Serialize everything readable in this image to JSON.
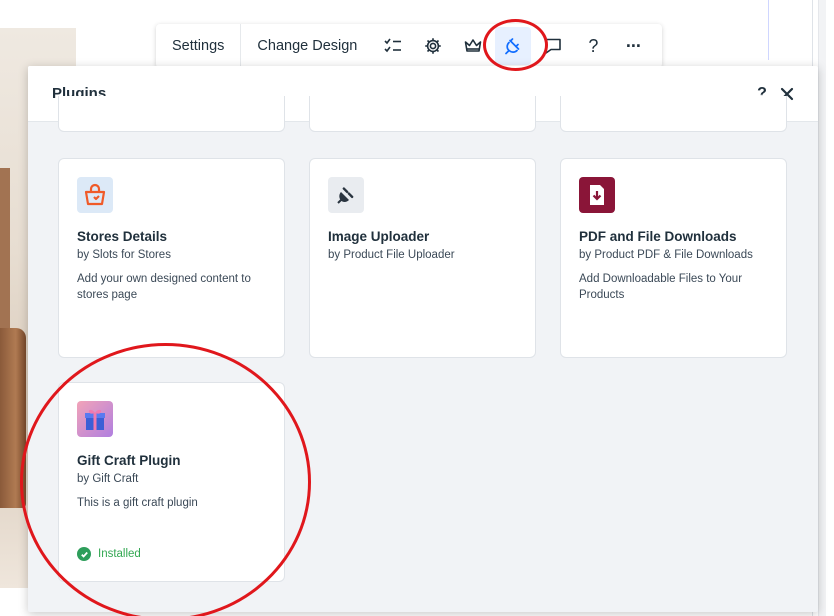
{
  "toolbar": {
    "settings_label": "Settings",
    "change_design_label": "Change Design",
    "icons": [
      "checklist-icon",
      "gear-icon",
      "crown-icon",
      "plug-icon",
      "comment-icon",
      "help-icon",
      "more-icon"
    ],
    "help_glyph": "?",
    "more_glyph": "···"
  },
  "panel": {
    "title": "Plugins",
    "help_glyph": "?",
    "plugins": [
      {
        "name": "Stores Details",
        "by": "by Slots for Stores",
        "description": "Add your own designed content to stores page",
        "icon": "shopping-bag-icon"
      },
      {
        "name": "Image Uploader",
        "by": "by Product File Uploader",
        "description": "",
        "icon": "plug-icon"
      },
      {
        "name": "PDF and File Downloads",
        "by": "by Product PDF & File Downloads",
        "description": "Add Downloadable Files to Your Products",
        "icon": "download-file-icon"
      },
      {
        "name": "Gift Craft Plugin",
        "by": "by Gift Craft",
        "description": "This is a gift craft plugin",
        "status": "Installed",
        "icon": "gift-box-icon"
      }
    ]
  },
  "colors": {
    "accent_blue": "#116dff",
    "annotation_red": "#e0171c",
    "installed_green": "#34a853",
    "panel_bg": "#f1f3f6"
  }
}
